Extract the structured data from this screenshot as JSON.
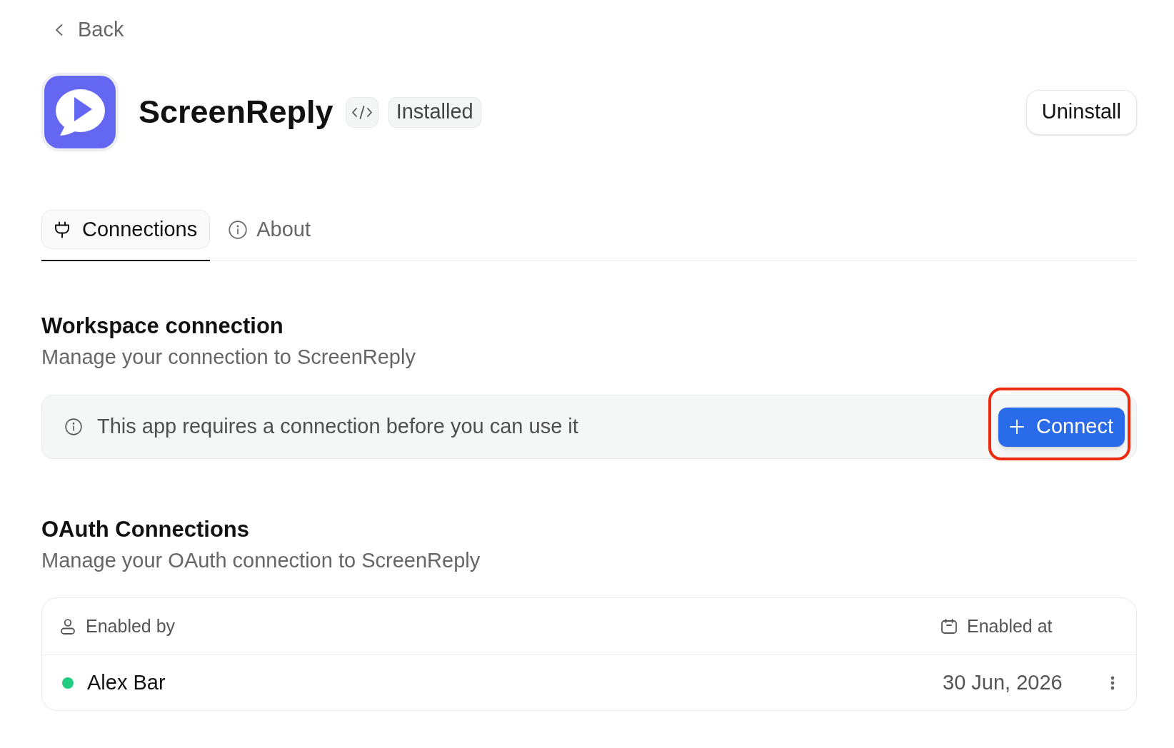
{
  "back_link": {
    "label": "Back"
  },
  "app": {
    "name": "ScreenReply",
    "status_badge": "Installed"
  },
  "uninstall_button": {
    "label": "Uninstall"
  },
  "tabs": [
    {
      "label": "Connections",
      "selected": true
    },
    {
      "label": "About",
      "selected": false
    }
  ],
  "workspace_connection": {
    "title": "Workspace connection",
    "subtitle": "Manage your connection to ScreenReply",
    "notice": "This app requires a connection before you can use it",
    "connect_button": {
      "label": "Connect",
      "highlighted": true
    }
  },
  "oauth_connections": {
    "title": "OAuth Connections",
    "subtitle": "Manage your OAuth connection to ScreenReply",
    "table": {
      "columns": [
        "Enabled by",
        "Enabled at"
      ],
      "rows": [
        {
          "enabled_by": "Alex Bar",
          "color": "#20cd83",
          "enabled_at": "30 Jun, 2026"
        }
      ]
    }
  }
}
